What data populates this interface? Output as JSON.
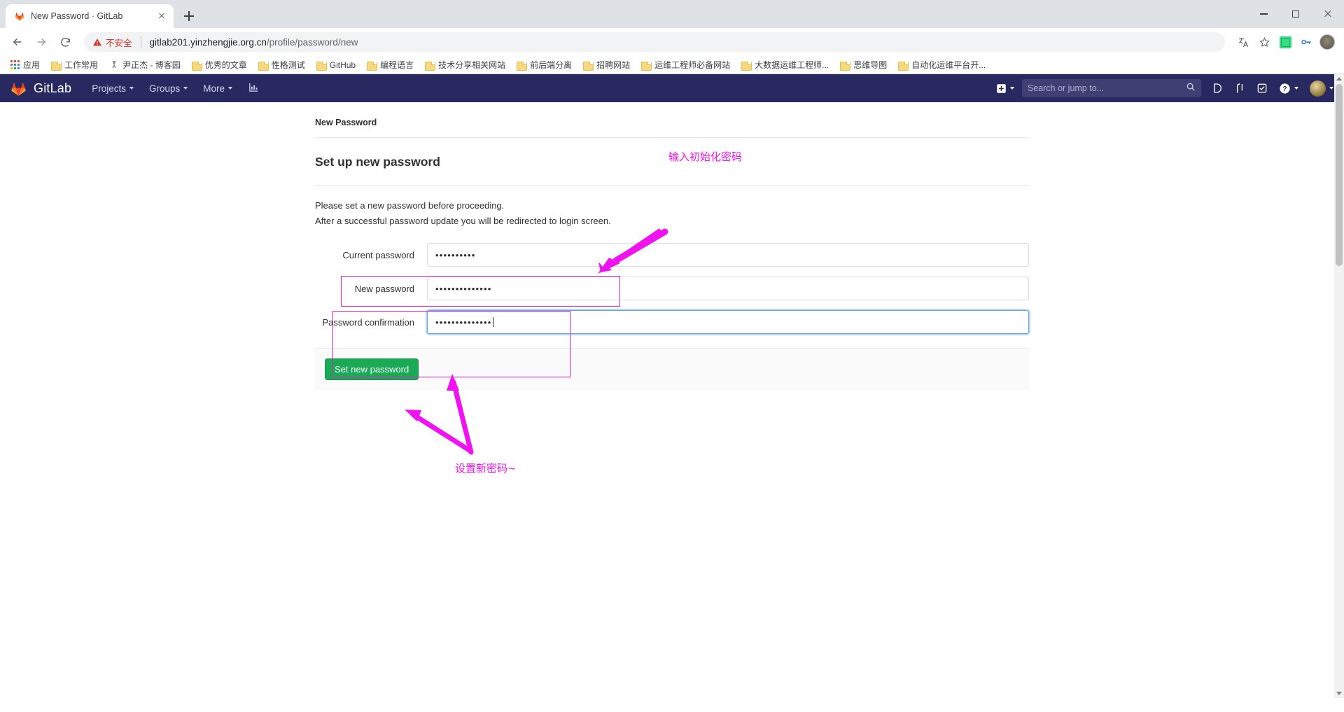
{
  "browser": {
    "tab": {
      "title": "New Password · GitLab",
      "favicon": "gitlab-favicon",
      "close": "close-icon"
    },
    "new_tab_label": "+",
    "window": {
      "minimize": "minimize-icon",
      "maximize": "maximize-icon",
      "close": "window-close-icon"
    },
    "nav": {
      "back": "back-arrow-icon",
      "forward": "forward-arrow-icon",
      "reload": "reload-icon"
    },
    "omnibox": {
      "security_label": "不安全",
      "security_icon": "warning-triangle-icon",
      "url_host": "gitlab201.yinzhengjie.org.cn",
      "url_path": "/profile/password/new"
    },
    "toolbar_right": {
      "translate": "translate-icon",
      "bookmark_star": "star-icon",
      "extension": "extension-icon",
      "password_manager": "key-icon",
      "profile": "profile-avatar-icon"
    },
    "bookmarks": [
      {
        "label": "应用",
        "icon": "apps-grid-icon"
      },
      {
        "label": "工作常用",
        "icon": "folder-icon"
      },
      {
        "label": "尹正杰 - 博客园",
        "icon": "cnblogs-icon"
      },
      {
        "label": "优秀的文章",
        "icon": "folder-icon"
      },
      {
        "label": "性格测试",
        "icon": "folder-icon"
      },
      {
        "label": "GitHub",
        "icon": "folder-icon"
      },
      {
        "label": "编程语言",
        "icon": "folder-icon"
      },
      {
        "label": "技术分享相关网站",
        "icon": "folder-icon"
      },
      {
        "label": "前后端分离",
        "icon": "folder-icon"
      },
      {
        "label": "招聘网站",
        "icon": "folder-icon"
      },
      {
        "label": "运维工程师必备网站",
        "icon": "folder-icon"
      },
      {
        "label": "大数据运维工程师...",
        "icon": "folder-icon"
      },
      {
        "label": "思维导图",
        "icon": "folder-icon"
      },
      {
        "label": "自动化运维平台开...",
        "icon": "folder-icon"
      }
    ]
  },
  "gitlab": {
    "brand": "GitLab",
    "nav_items": [
      {
        "label": "Projects",
        "caret": true
      },
      {
        "label": "Groups",
        "caret": true
      },
      {
        "label": "More",
        "caret": true
      }
    ],
    "analytics_icon": "chart-icon",
    "right": {
      "plus_icon": "plus-square-icon",
      "search_placeholder": "Search or jump to...",
      "search_icon": "search-icon",
      "issues_icon": "issues-icon",
      "merge_requests_icon": "merge-request-icon",
      "todos_icon": "todos-checkbox-icon",
      "help_icon": "question-circle-icon",
      "avatar_icon": "user-avatar-icon"
    },
    "accent_color": "#292961",
    "button_color": "#1aaa55"
  },
  "main": {
    "breadcrumb": "New Password",
    "page_title": "Set up new password",
    "lead_line_1": "Please set a new password before proceeding.",
    "lead_line_2": "After a successful password update you will be redirected to login screen.",
    "fields": [
      {
        "label": "Current password",
        "value": "••••••••••",
        "focused": false
      },
      {
        "label": "New password",
        "value": "••••••••••••••",
        "focused": false
      },
      {
        "label": "Password confirmation",
        "value": "••••••••••••••",
        "focused": true
      }
    ],
    "submit_label": "Set new password"
  },
  "annotations": {
    "color": "#f012f0",
    "note_top": "输入初始化密码",
    "note_bottom": "设置新密码~"
  }
}
